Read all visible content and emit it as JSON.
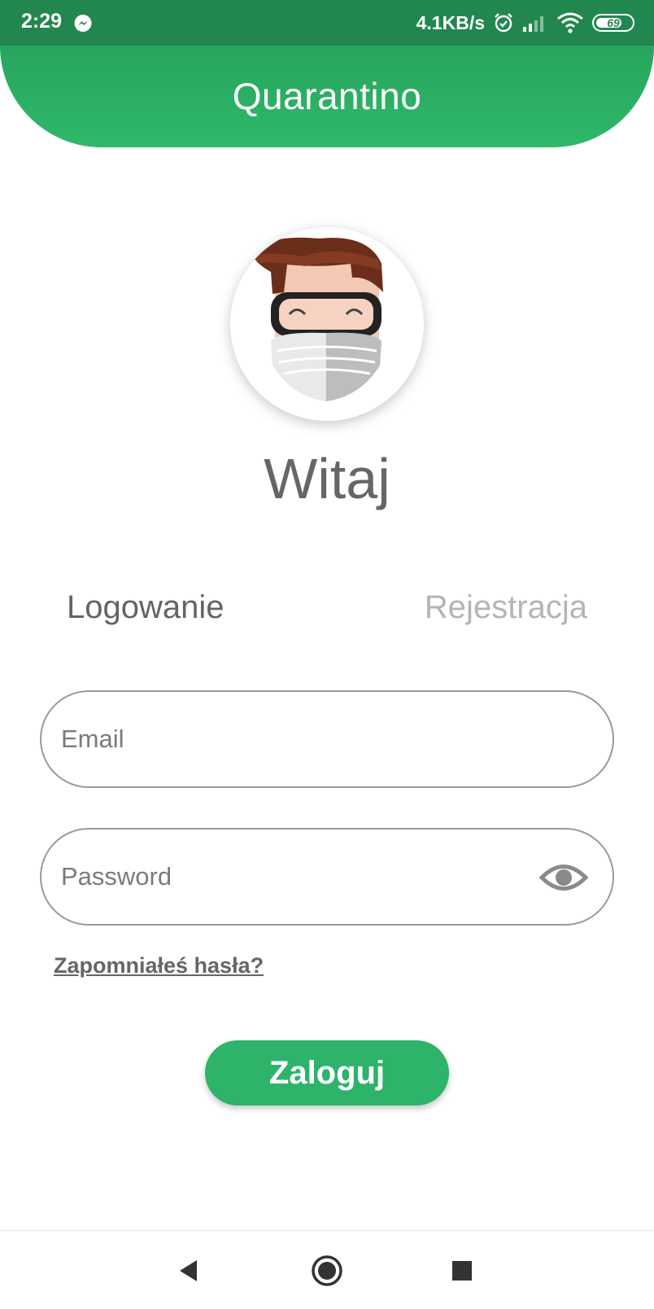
{
  "status_bar": {
    "time": "2:29",
    "net_speed": "4.1KB/s",
    "battery_level": "69",
    "background_color": "#22874f",
    "icons": [
      "messenger-icon",
      "alarm-icon",
      "signal-icon",
      "wifi-icon",
      "battery-icon"
    ]
  },
  "header": {
    "title": "Quarantino",
    "background_color": "#2eb46a"
  },
  "greeting": "Witaj",
  "tabs": [
    {
      "label": "Logowanie",
      "active": true
    },
    {
      "label": "Rejestracja",
      "active": false
    }
  ],
  "form": {
    "email_placeholder": "Email",
    "email_value": "",
    "password_placeholder": "Password",
    "password_value": "",
    "password_toggle_icon": "eye-icon",
    "forgot_password": "Zapomniałeś hasła?",
    "submit_label": "Zaloguj",
    "accent_color": "#2db36a"
  },
  "nav_bar": {
    "icons": [
      "back-icon",
      "home-icon",
      "recents-icon"
    ]
  }
}
